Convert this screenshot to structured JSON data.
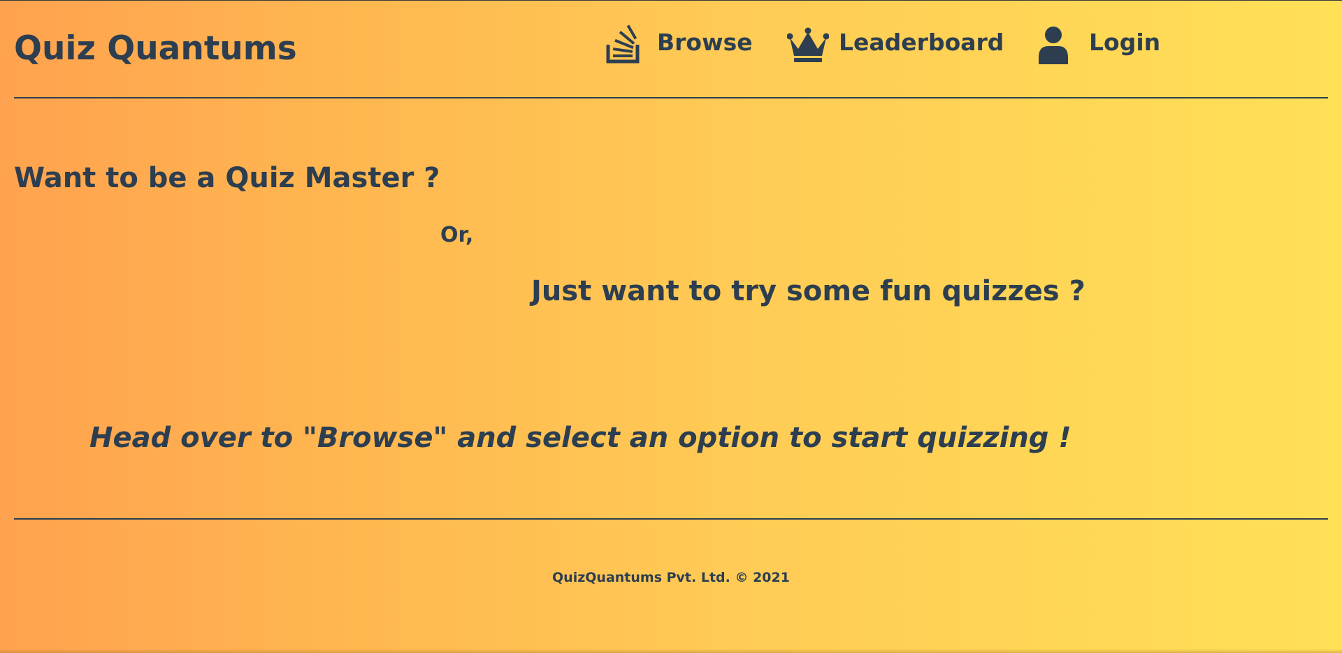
{
  "header": {
    "brand": "Quiz Quantums",
    "nav": [
      {
        "label": "Browse",
        "icon": "stack-overflow-icon"
      },
      {
        "label": "Leaderboard",
        "icon": "crown-icon"
      },
      {
        "label": "Login",
        "icon": "user-icon"
      }
    ]
  },
  "main": {
    "question_master": "Want to be a Quiz Master ?",
    "or_text": "Or,",
    "question_fun": "Just want to try some fun quizzes ?",
    "call_to_action": "Head over to \"Browse\" and select an option to start quizzing !"
  },
  "footer": {
    "copyright": "QuizQuantums Pvt. Ltd. © 2021"
  },
  "colors": {
    "text": "#2c3e50",
    "gradient_start": "#ffa24f",
    "gradient_end": "#ffe057"
  }
}
